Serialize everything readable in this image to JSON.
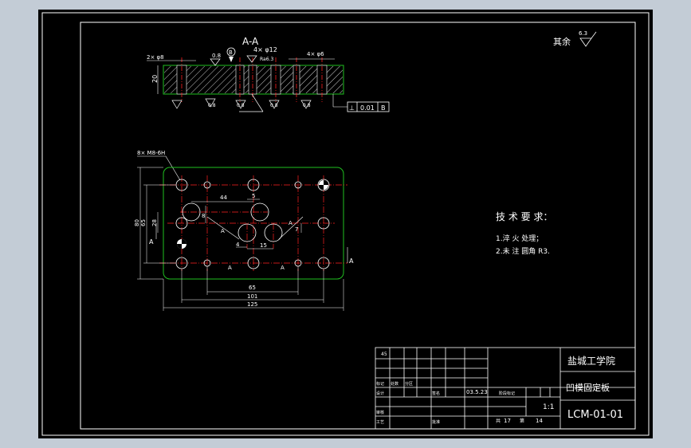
{
  "colors": {
    "background": "#c3ccd6",
    "sheet": "#000000",
    "line": "#ffffff",
    "center_line": "#ff2020",
    "outline": "#20c020",
    "section_hatch": "#ffffff",
    "dimension": "#ffffff"
  },
  "section_view": {
    "title": "A-A",
    "callouts": [
      "2× φ8",
      "0.8",
      "B",
      "4× φ12",
      "Ra6.3",
      "4× φ6",
      "20"
    ],
    "bottom_callouts": [
      "0.8",
      "0.8",
      "0.8",
      "0.8"
    ],
    "tolerance_frame": [
      "⊥",
      "0.01",
      "B"
    ]
  },
  "surface_finish_default": {
    "label": "其余",
    "value": "6.3"
  },
  "plan_view": {
    "thread_callout": "8× M8-6H",
    "dimensions": [
      "44",
      "5",
      "8",
      "15",
      "4",
      "7",
      "65",
      "101",
      "125",
      "80",
      "65",
      "28"
    ],
    "section_markers": [
      "A",
      "A",
      "A",
      "A",
      "A",
      "A"
    ]
  },
  "tech_requirements": {
    "heading": "技 术 要 求：",
    "items": [
      "1.淬 火 处理；",
      "2.未 注 圆角 R3."
    ]
  },
  "title_block": {
    "school": "盐城工学院",
    "part_name": "凹模固定板",
    "drawing_no": "LCM-01-01",
    "material": "45",
    "scale": "1:1",
    "date": "03.5.23",
    "sheet_total": "17",
    "sheet_no": "14",
    "row_labels": [
      "标记",
      "设计",
      "审核",
      "工艺"
    ],
    "col_labels": [
      "处数",
      "分区",
      "签名",
      "批准"
    ],
    "stage_label": "阶段标记",
    "sheet_total_label": "共",
    "sheet_no_label": "第"
  }
}
